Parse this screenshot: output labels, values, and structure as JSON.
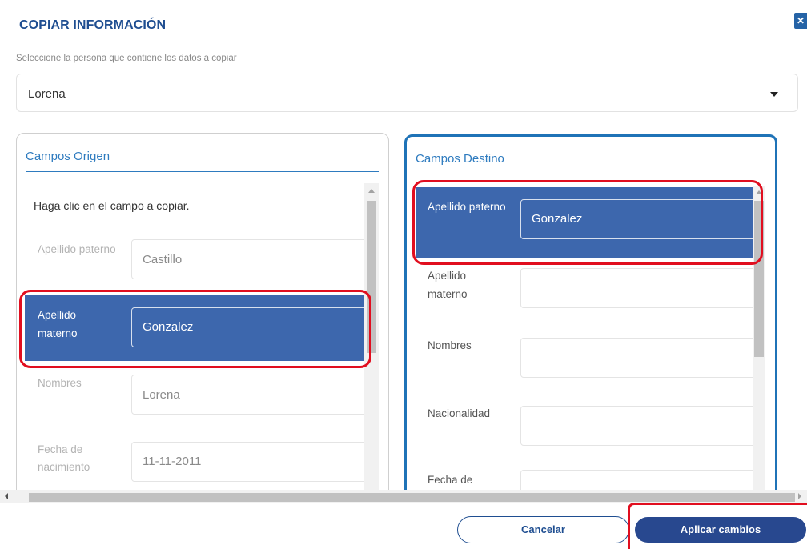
{
  "dialog": {
    "title": "COPIAR INFORMACIÓN",
    "close_icon": "close-icon",
    "subtitle": "Seleccione la persona que contiene los datos a copiar",
    "person_select": {
      "selected": "Lorena"
    }
  },
  "origin": {
    "title": "Campos Origen",
    "instruction": "Haga clic en el campo a copiar.",
    "fields": [
      {
        "label": "Apellido paterno",
        "value": "Castillo"
      },
      {
        "label_line1": "Apellido",
        "label_line2": "materno",
        "value": "Gonzalez",
        "selected": true
      },
      {
        "label": "Nombres",
        "value": "Lorena"
      },
      {
        "label_line1": "Fecha de",
        "label_line2": "nacimiento",
        "value": "11-11-2011"
      }
    ]
  },
  "destination": {
    "title": "Campos Destino",
    "fields": [
      {
        "label": "Apellido paterno",
        "value": "Gonzalez",
        "selected": true
      },
      {
        "label_line1": "Apellido",
        "label_line2": "materno",
        "value": ""
      },
      {
        "label": "Nombres",
        "value": ""
      },
      {
        "label": "Nacionalidad",
        "value": ""
      },
      {
        "label": "Fecha de",
        "value": ""
      }
    ]
  },
  "footer": {
    "cancel_label": "Cancelar",
    "apply_label": "Aplicar cambios"
  },
  "colors": {
    "brand": "#1f4e91",
    "selected_row": "#3d67ad",
    "accent_border": "#1f73b7",
    "highlight_ring": "#e10e1f"
  }
}
